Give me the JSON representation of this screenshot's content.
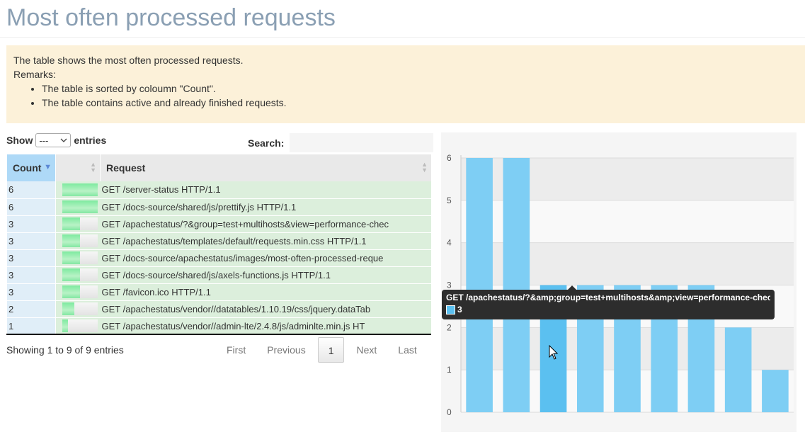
{
  "page": {
    "title": "Most often processed requests"
  },
  "notice": {
    "intro": "The table shows the most often processed requests.",
    "remarks_label": "Remarks:",
    "remarks": [
      "The table is sorted by coloumn \"Count\".",
      "The table contains active and already finished requests."
    ]
  },
  "controls": {
    "show_label": "Show",
    "entries_value": "---",
    "entries_label": "entries",
    "search_label": "Search:",
    "search_value": ""
  },
  "table": {
    "columns": [
      "Count",
      "",
      "Request"
    ],
    "max_count": 6,
    "rows": [
      {
        "count": "6",
        "request": "GET /server-status HTTP/1.1"
      },
      {
        "count": "6",
        "request": "GET /docs-source/shared/js/prettify.js HTTP/1.1"
      },
      {
        "count": "3",
        "request": "GET /apachestatus/?&group=test+multihosts&view=performance-chec"
      },
      {
        "count": "3",
        "request": "GET /apachestatus/templates/default/requests.min.css HTTP/1.1"
      },
      {
        "count": "3",
        "request": "GET /docs-source/apachestatus/images/most-often-processed-reque"
      },
      {
        "count": "3",
        "request": "GET /docs-source/shared/js/axels-functions.js HTTP/1.1"
      },
      {
        "count": "3",
        "request": "GET /favicon.ico HTTP/1.1"
      },
      {
        "count": "2",
        "request": "GET /apachestatus/vendor//datatables/1.10.19/css/jquery.dataTab"
      },
      {
        "count": "1",
        "request": "GET /apachestatus/vendor//admin-lte/2.4.8/js/adminlte.min.js HT"
      }
    ]
  },
  "footer": {
    "info": "Showing 1 to 9 of 9 entries",
    "pagination": {
      "first": "First",
      "previous": "Previous",
      "current": "1",
      "next": "Next",
      "last": "Last"
    }
  },
  "chart_data": {
    "type": "bar",
    "values": [
      6,
      6,
      3,
      3,
      3,
      3,
      3,
      2,
      1
    ],
    "ylim": [
      0,
      6
    ],
    "yticks": [
      "0",
      "1",
      "2",
      "3",
      "4",
      "5",
      "6"
    ],
    "grid": true,
    "highlighted_index": 2,
    "bar_color": "#7ecef4",
    "highlight_color": "#5bc0f0",
    "tooltip": {
      "title": "GET /apachestatus/?&amp;group=test+multihosts&amp;view=performance-chec",
      "value": "3"
    }
  }
}
